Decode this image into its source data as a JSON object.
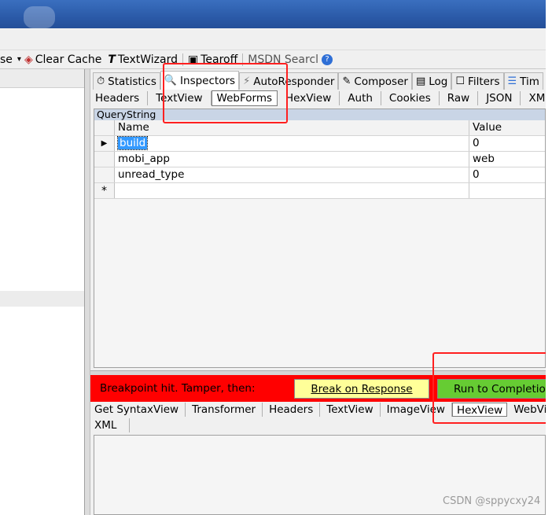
{
  "toolbar": {
    "partial_item": "se",
    "partial_arrow": "▾",
    "clear_cache": "Clear Cache",
    "text_wizard": "TextWizard",
    "tearoff": "Tearoff",
    "msdn_search": "MSDN Searcl"
  },
  "main_tabs": {
    "statistics": "Statistics",
    "inspectors": "Inspectors",
    "autoresponder": "AutoResponder",
    "composer": "Composer",
    "log": "Log",
    "filters": "Filters",
    "timeline": "Tim"
  },
  "request_tabs": [
    "Headers",
    "TextView",
    "WebForms",
    "HexView",
    "Auth",
    "Cookies",
    "Raw",
    "JSON",
    "XML"
  ],
  "querystring": {
    "title": "QueryString",
    "col_name": "Name",
    "col_value": "Value",
    "rows": [
      {
        "name": "build",
        "value": "0"
      },
      {
        "name": "mobi_app",
        "value": "web"
      },
      {
        "name": "unread_type",
        "value": "0"
      }
    ],
    "row_marker": "▶",
    "new_row_marker": "*"
  },
  "breakpoint": {
    "message": "Breakpoint hit. Tamper, then:",
    "break_on_response": "Break on Response",
    "run_to_completion": "Run to Completion"
  },
  "response_tabs_row1": [
    "Get SyntaxView",
    "Transformer",
    "Headers",
    "TextView",
    "ImageView",
    "HexView",
    "WebView"
  ],
  "response_tabs_row2": [
    "XML"
  ],
  "watermark": "CSDN @sppycxy24",
  "colors": {
    "accent_red": "#ff0000",
    "break_button": "#ffff99",
    "run_button": "#66cc33",
    "selection": "#3399ff"
  }
}
